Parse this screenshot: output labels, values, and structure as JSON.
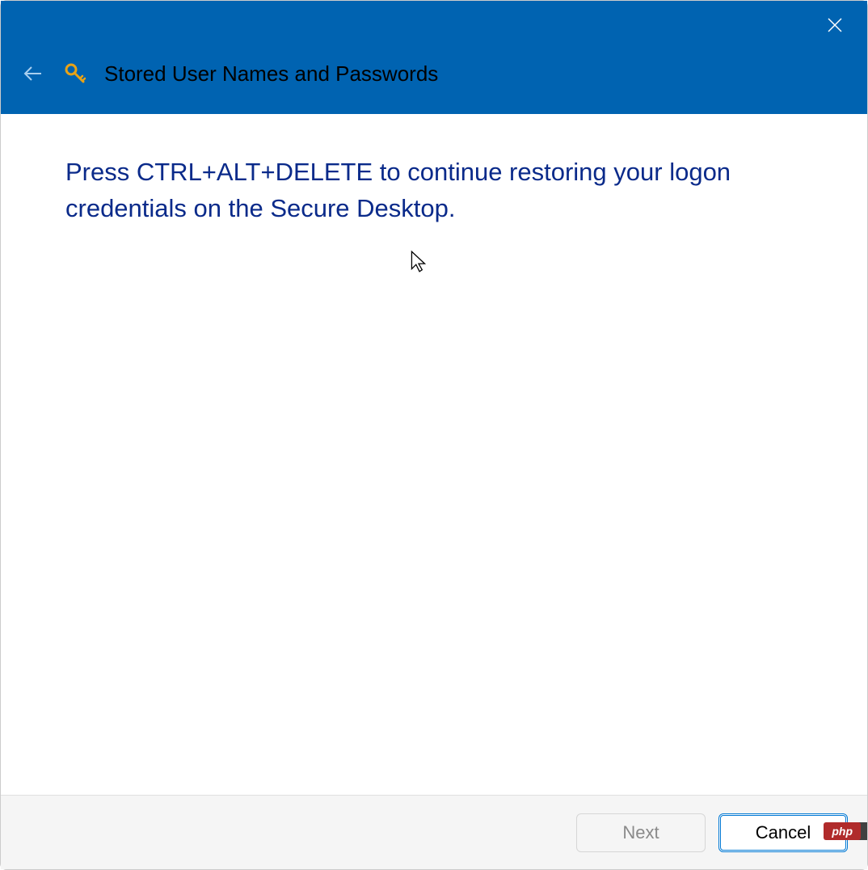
{
  "header": {
    "title": "Stored User Names and Passwords"
  },
  "main": {
    "instruction": "Press CTRL+ALT+DELETE to continue restoring your logon credentials on the Secure Desktop."
  },
  "footer": {
    "next_label": "Next",
    "cancel_label": "Cancel"
  },
  "watermark": {
    "text": "php"
  }
}
